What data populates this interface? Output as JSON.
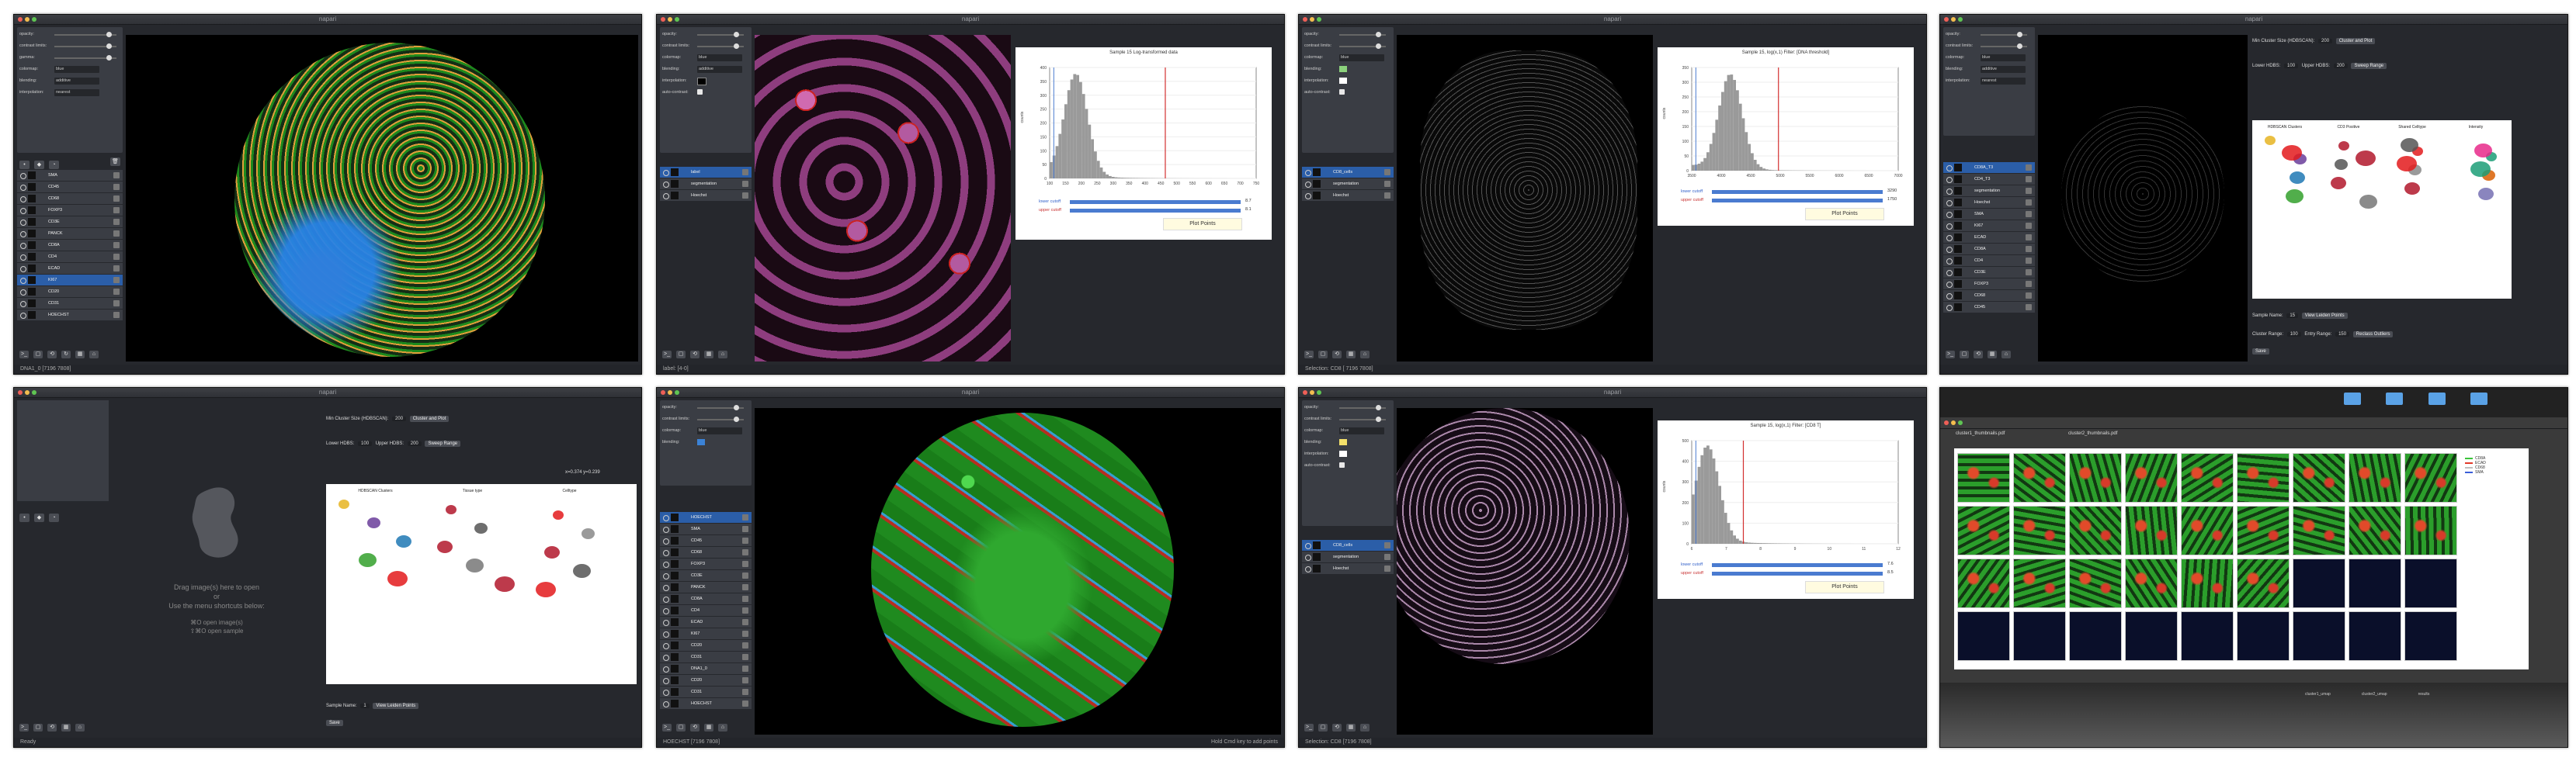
{
  "app_title": "napari",
  "colors": {
    "window_bg": "#26282d",
    "selected": "#2b5ea8",
    "plot_line": "#d32f2f",
    "bar_blue": "#4a7bd0",
    "plot_button": "#fffbe0"
  },
  "layer_controls": {
    "labels": [
      "opacity:",
      "contrast limits:",
      "gamma:",
      "colormap:",
      "blending:",
      "interpolation:",
      "auto-contrast:"
    ],
    "colormap_value": "blue",
    "blending_value": "additive",
    "interpolation_value": "nearest"
  },
  "icons": [
    "points-layer-icon",
    "shapes-layer-icon",
    "labels-layer-icon",
    "delete-layer-icon",
    "console-icon",
    "ndisplay-icon",
    "transpose-icon",
    "grid-icon",
    "home-icon"
  ],
  "panel1": {
    "layers": [
      "SMA",
      "CD45",
      "CD68",
      "FOXP3",
      "CD3E",
      "PANCK",
      "CD8A",
      "CD4",
      "ECAD",
      "KI67",
      "CD20",
      "CD31",
      "HOECHST"
    ],
    "selected": 9,
    "status": "DNA1_0 [7196 7808]"
  },
  "panel2": {
    "layers": [
      "label",
      "segmentation",
      "Hoechst"
    ],
    "selected": 0,
    "status": "label: [4-0]",
    "chart_title": "Sample 15 Log-transformed data",
    "lower_label": "lower cutoff",
    "upper_label": "upper cutoff",
    "lower_value": "8.7",
    "upper_value": "8.1",
    "plot_button": "Plot Points",
    "y_axis_label": "counts",
    "y_ticks": [
      "400",
      "350",
      "300",
      "250",
      "200",
      "150",
      "100",
      "50",
      "0"
    ],
    "x_ticks": [
      "100",
      "150",
      "200",
      "250",
      "300",
      "350",
      "400",
      "450",
      "500",
      "550",
      "600",
      "650",
      "700",
      "750"
    ]
  },
  "panel3": {
    "layers": [
      "CD8_cells",
      "segmentation",
      "Hoechst"
    ],
    "selected": 0,
    "status": "Selection: CD8 [ 7196 7808]",
    "chart_title": "Sample 15, log(x,1) Filter: [DNA threshold]",
    "lower_label": "lower cutoff",
    "upper_label": "upper cutoff",
    "lower_value": "3290",
    "upper_value": "1750",
    "plot_button": "Plot Points",
    "y_axis_label": "counts",
    "y_ticks": [
      "350",
      "300",
      "250",
      "200",
      "150",
      "100",
      "50",
      "0"
    ],
    "x_ticks": [
      "3500",
      "4000",
      "4500",
      "5000",
      "5500",
      "6000",
      "6500",
      "7000"
    ]
  },
  "panel4": {
    "top_label": "Min Cluster Size (HDBSCAN):",
    "top_combo": "200",
    "top_button": "Cluster and Plot",
    "second_label": "Lower HDBS:",
    "second_combo": "100",
    "second_label2": "Upper HDBS:",
    "second_combo2": "200",
    "second_button": "Sweep Range",
    "umap_titles": [
      "HDBSCAN Clusters",
      "CD3 Positive",
      "Shared Celltype",
      "Intensity"
    ],
    "sample_label": "Sample Name:",
    "sample_value": "15",
    "sample_button": "View Leiden Points",
    "cluster_label": "Cluster Range:",
    "cluster_value": "100",
    "entry_label": "Entry Range:",
    "entry_value": "150",
    "reclass_button": "Reclass Outliers",
    "save_button": "Save",
    "layers": [
      "CD8A_T3",
      "CD4_T3",
      "segmentation",
      "Hoechst",
      "SMA",
      "KI67",
      "ECAD",
      "CD8A",
      "CD4",
      "CD3E",
      "FOXP3",
      "CD68",
      "CD45"
    ],
    "selected": 0
  },
  "panel5": {
    "drop_text_1": "Drag image(s) here to open",
    "drop_text_2": "or",
    "drop_text_3": "Use the menu shortcuts below:",
    "shortcut_1": "⌘O  open image(s)",
    "shortcut_2": "⇧⌘O  open sample",
    "top_label": "Min Cluster Size (HDBSCAN):",
    "top_combo": "200",
    "top_button": "Cluster and Plot",
    "second_label": "Lower HDBS:",
    "second_combo": "100",
    "second_label2": "Upper HDBS:",
    "second_combo2": "200",
    "second_button": "Sweep Range",
    "coords": "x=0.374 y=0.239",
    "umap_titles": [
      "HDBSCAN Clusters",
      "Tissue type",
      "Celltype"
    ],
    "sample_label": "Sample Name:",
    "sample_value": "1",
    "sample_button": "View Leiden Points",
    "save_button": "Save",
    "status": "Ready"
  },
  "panel6": {
    "layers": [
      "HOECHST",
      "SMA",
      "CD45",
      "CD68",
      "FOXP3",
      "CD3E",
      "PANCK",
      "CD8A",
      "CD4",
      "ECAD",
      "KI67",
      "CD20",
      "CD31",
      "DNA1_0",
      "CD20",
      "CD31",
      "HOECHST"
    ],
    "selected": 0,
    "status": "HOECHST [7196 7808]",
    "status_right": "Hold Cmd key to add points"
  },
  "panel7": {
    "layers": [
      "CD8_cells",
      "segmentation",
      "Hoechst"
    ],
    "selected": 0,
    "status": "Selection: CD8 [7196 7808]",
    "chart_title": "Sample 15, log(x,1) Filter: [CD8 T]",
    "lower_label": "lower cutoff",
    "upper_label": "upper cutoff",
    "lower_value": "7.6",
    "upper_value": "8.5",
    "plot_button": "Plot Points",
    "y_axis_label": "counts",
    "y_ticks": [
      "500",
      "400",
      "300",
      "200",
      "100",
      "0"
    ],
    "x_ticks": [
      "6",
      "7",
      "8",
      "9",
      "10",
      "11",
      "12"
    ]
  },
  "panel8": {
    "file_tab_1": "cluster1_thumbnails.pdf",
    "file_tab_2": "cluster2_thumbnails.pdf",
    "legend": [
      "CD8A",
      "ECAD",
      "CD68",
      "SMA"
    ],
    "grid_rows": 4,
    "grid_cols": 9,
    "filled_cells": 24,
    "folder_labels": [
      "cluster1_umap",
      "cluster2_umap",
      "results"
    ]
  }
}
